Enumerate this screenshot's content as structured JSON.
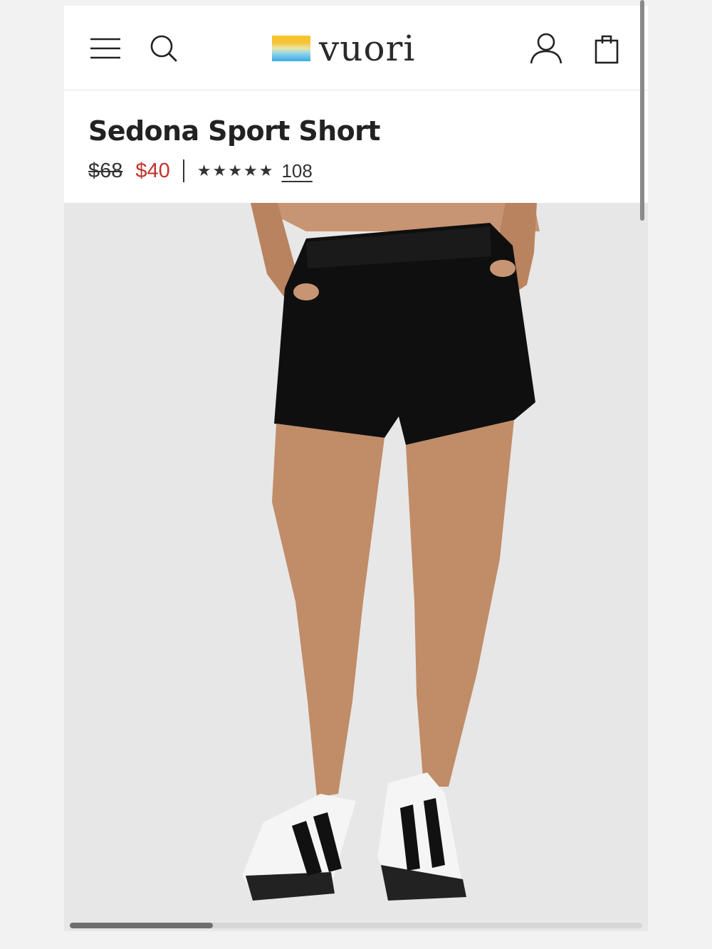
{
  "header": {
    "brand": "vuori",
    "icons": {
      "menu": "hamburger-menu-icon",
      "search": "search-icon",
      "account": "account-icon",
      "bag": "shopping-bag-icon"
    }
  },
  "product": {
    "title": "Sedona Sport Short",
    "original_price": "$68",
    "sale_price": "$40",
    "rating": 5,
    "rating_max": 5,
    "review_count": "108"
  },
  "colors": {
    "sale_price": "#c0342b",
    "text": "#222222",
    "hero_background": "#e7e7e7"
  },
  "carousel": {
    "position_fraction": 0.25
  }
}
